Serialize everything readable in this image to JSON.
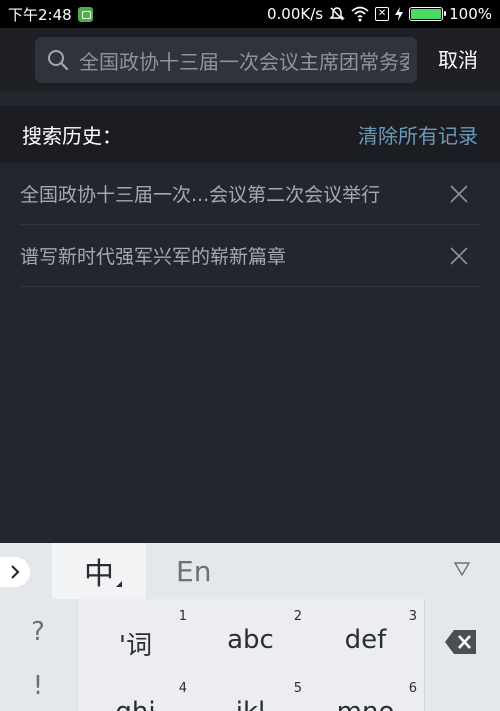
{
  "status_bar": {
    "time": "下午2:48",
    "network_speed": "0.00K/s",
    "battery": "100%",
    "battery_level": 1.0,
    "icons": [
      "app-icon",
      "mute-icon",
      "wifi-icon",
      "sim-off-icon",
      "charging-icon",
      "battery-icon"
    ]
  },
  "search": {
    "query": "全国政协十三届一次会议主席团常务委员会",
    "cancel_label": "取消",
    "icon": "search-icon"
  },
  "history": {
    "title": "搜索历史：",
    "clear_label": "清除所有记录",
    "items": [
      {
        "text": "全国政协十三届一次...会议第二次会议举行"
      },
      {
        "text": "谱写新时代强军兴军的崭新篇章"
      }
    ]
  },
  "keyboard": {
    "tabs": {
      "zh": "中",
      "en": "En"
    },
    "symbols": [
      "?",
      "!"
    ],
    "keys": [
      {
        "label": "'词",
        "num": "1"
      },
      {
        "label": "abc",
        "num": "2"
      },
      {
        "label": "def",
        "num": "3"
      },
      {
        "label": "ghi",
        "num": "4"
      },
      {
        "label": "jkl",
        "num": "5"
      },
      {
        "label": "mno",
        "num": "6"
      }
    ]
  },
  "colors": {
    "background": "#23262d",
    "accent_link": "#6b9ab8",
    "battery_green": "#4cd964"
  }
}
